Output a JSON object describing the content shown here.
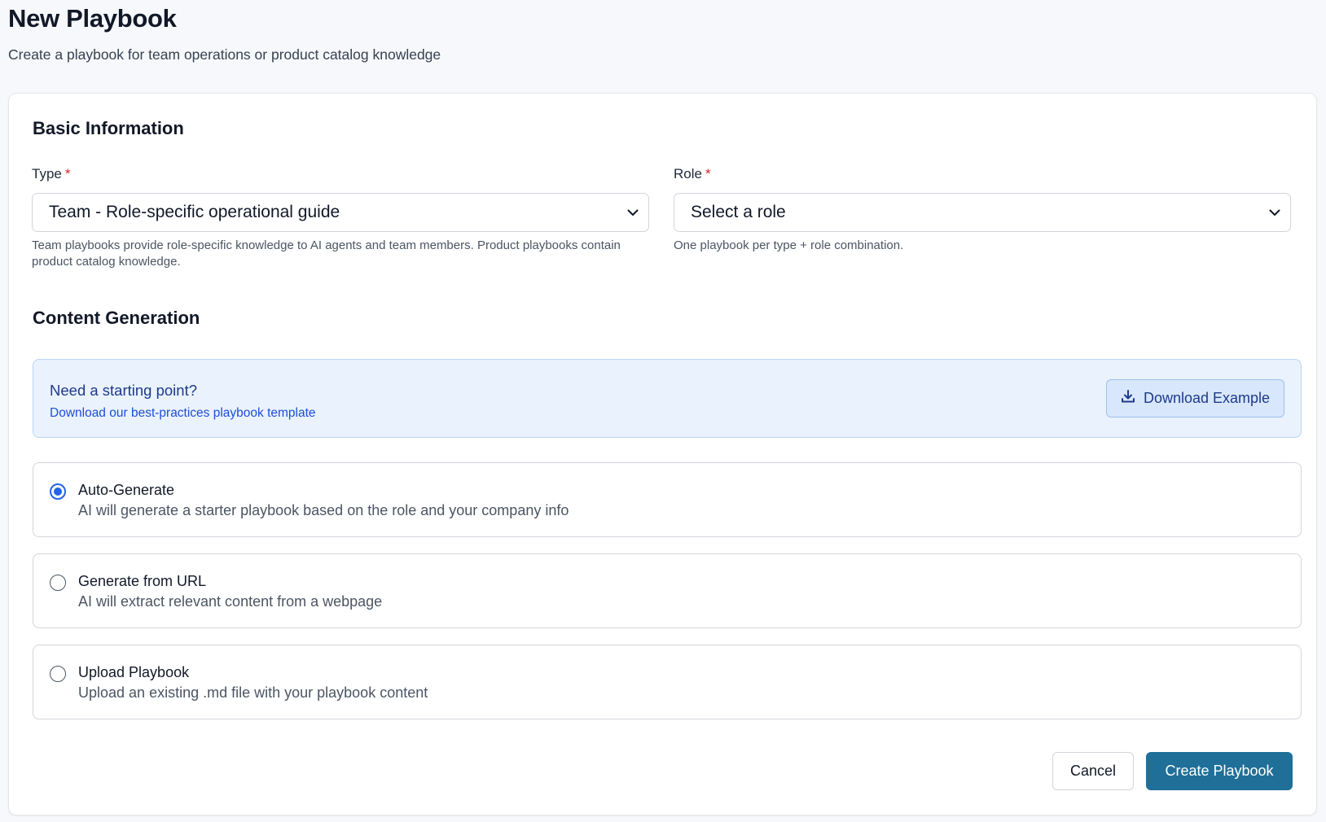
{
  "header": {
    "title": "New Playbook",
    "subtitle": "Create a playbook for team operations or product catalog knowledge"
  },
  "basic_info": {
    "section_title": "Basic Information",
    "type": {
      "label": "Type",
      "required_mark": "*",
      "selected": "Team - Role-specific operational guide",
      "help": "Team playbooks provide role-specific knowledge to AI agents and team members. Product playbooks contain product catalog knowledge."
    },
    "role": {
      "label": "Role",
      "required_mark": "*",
      "selected": "Select a role",
      "help": "One playbook per type + role combination."
    }
  },
  "content_generation": {
    "section_title": "Content Generation",
    "banner": {
      "title": "Need a starting point?",
      "link": "Download our best-practices playbook template",
      "button_label": "Download Example",
      "button_icon": "download-icon"
    },
    "options": [
      {
        "title": "Auto-Generate",
        "description": "AI will generate a starter playbook based on the role and your company info",
        "selected": true
      },
      {
        "title": "Generate from URL",
        "description": "AI will extract relevant content from a webpage",
        "selected": false
      },
      {
        "title": "Upload Playbook",
        "description": "Upload an existing .md file with your playbook content",
        "selected": false
      }
    ]
  },
  "actions": {
    "cancel_label": "Cancel",
    "create_label": "Create Playbook"
  },
  "colors": {
    "primary": "#1f6f99",
    "accent_blue": "#2563eb",
    "banner_bg": "#eaf2fd",
    "required": "#dc2626"
  }
}
